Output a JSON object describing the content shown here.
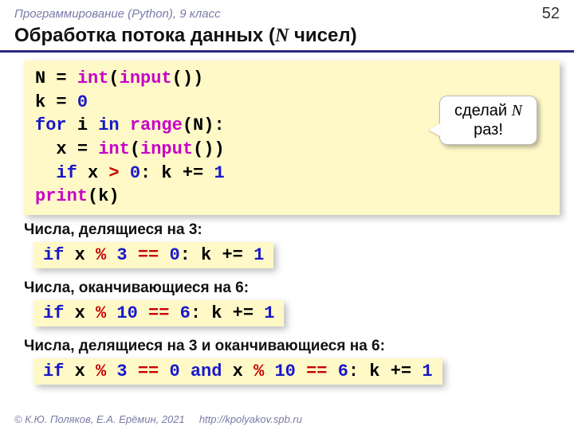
{
  "header": {
    "course": "Программирование (Python), 9 класс",
    "page": "52"
  },
  "title": {
    "pre": "Обработка потока данных (",
    "var": "N",
    "post": " чисел)"
  },
  "code": {
    "l1a": "N ",
    "l1b": "= ",
    "l1c": "int",
    "l1d": "(",
    "l1e": "input",
    "l1f": "())",
    "l2a": "k ",
    "l2b": "= ",
    "l2c": "0",
    "l3a": "for ",
    "l3b": "i ",
    "l3c": "in ",
    "l3d": "range",
    "l3e": "(N):",
    "l4a": "  x ",
    "l4b": "= ",
    "l4c": "int",
    "l4d": "(",
    "l4e": "input",
    "l4f": "())",
    "l5a": "  ",
    "l5b": "if ",
    "l5c": "x ",
    "l5d": "> ",
    "l5e": "0",
    "l5f": ": k ",
    "l5g": "+= ",
    "l5h": "1",
    "l6a": "print",
    "l6b": "(k)"
  },
  "callout": {
    "pre": "сделай ",
    "var": "N",
    "post": "раз!"
  },
  "sections": {
    "s1": {
      "title": "Числа, делящиеся на 3:",
      "c": {
        "a": "if ",
        "b": "x ",
        "c": "% ",
        "d": "3 ",
        "e": "== ",
        "f": "0",
        "g": ": k ",
        "h": "+= ",
        "i": "1"
      }
    },
    "s2": {
      "title": "Числа, оканчивающиеся на 6:",
      "c": {
        "a": "if ",
        "b": "x ",
        "c": "% ",
        "d": "10 ",
        "e": "== ",
        "f": "6",
        "g": ": k ",
        "h": "+= ",
        "i": "1"
      }
    },
    "s3": {
      "title": "Числа, делящиеся на 3 и оканчивающиеся на 6:",
      "c": {
        "a": "if ",
        "b": "x ",
        "c": "% ",
        "d": "3 ",
        "e": "== ",
        "f": "0 ",
        "g": "and ",
        "h": "x ",
        "i": "% ",
        "j": "10 ",
        "k": "== ",
        "l": "6",
        "m": ": k ",
        "n": "+= ",
        "o": "1"
      }
    }
  },
  "footer": {
    "copyright": "© К.Ю. Поляков, Е.А. Ерёмин, 2021",
    "url": "http://kpolyakov.spb.ru"
  }
}
